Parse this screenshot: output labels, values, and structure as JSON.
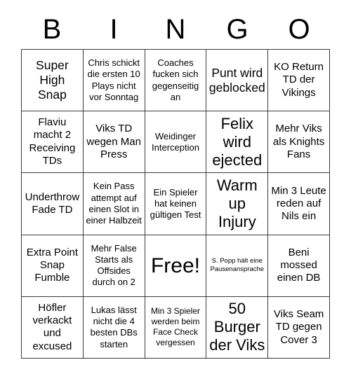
{
  "card": {
    "title": "BINGO",
    "header_letters": [
      "B",
      "I",
      "N",
      "G",
      "O"
    ],
    "colors": {
      "background": "#ffffff",
      "text": "#000000",
      "grid_line": "#3a3a3a"
    },
    "grid": {
      "columns": 5,
      "rows": 5,
      "free_space_index": 12,
      "cells": [
        {
          "text": "Super High Snap",
          "size": "lg",
          "free": false
        },
        {
          "text": "Chris schickt die ersten 10 Plays nicht vor Sonntag",
          "size": "sm",
          "free": false
        },
        {
          "text": "Coaches fucken sich gegenseitig an",
          "size": "sm",
          "free": false
        },
        {
          "text": "Punt wird geblocked",
          "size": "lg",
          "free": false
        },
        {
          "text": "KO Return TD der Vikings",
          "size": "md",
          "free": false
        },
        {
          "text": "Flaviu macht 2 Receiving TDs",
          "size": "md",
          "free": false
        },
        {
          "text": "Viks TD wegen Man Press",
          "size": "md",
          "free": false
        },
        {
          "text": "Weidinger Interception",
          "size": "sm",
          "free": false
        },
        {
          "text": "Felix wird ejected",
          "size": "xl",
          "free": false
        },
        {
          "text": "Mehr Viks als Knights Fans",
          "size": "md",
          "free": false
        },
        {
          "text": "Underthrow Fade TD",
          "size": "md",
          "free": false
        },
        {
          "text": "Kein Pass attempt auf einen Slot in einer Halbzeit",
          "size": "sm",
          "free": false
        },
        {
          "text": "Ein Spieler hat keinen gültigen Test",
          "size": "sm",
          "free": false
        },
        {
          "text": "Warm up Injury",
          "size": "xl",
          "free": false
        },
        {
          "text": "Min 3 Leute reden auf Nils ein",
          "size": "md",
          "free": false
        },
        {
          "text": "Extra Point Snap Fumble",
          "size": "md",
          "free": false
        },
        {
          "text": "Mehr False Starts als Offsides durch on 2",
          "size": "sm",
          "free": false
        },
        {
          "text": "Free!",
          "size": "xxl",
          "free": true
        },
        {
          "text": "S. Popp hält eine Pausenansprache",
          "size": "xxs",
          "free": false
        },
        {
          "text": "Beni mossed einen DB",
          "size": "md",
          "free": false
        },
        {
          "text": "Höfler verkackt und excused",
          "size": "md",
          "free": false
        },
        {
          "text": "Lukas lässt nicht die 4 besten DBs starten",
          "size": "sm",
          "free": false
        },
        {
          "text": "Min 3 Spieler werden beim Face Check vergessen",
          "size": "xs",
          "free": false
        },
        {
          "text": "50 Burger der Viks",
          "size": "xl",
          "free": false
        },
        {
          "text": "Viks Seam TD gegen Cover 3",
          "size": "md",
          "free": false
        }
      ]
    }
  }
}
